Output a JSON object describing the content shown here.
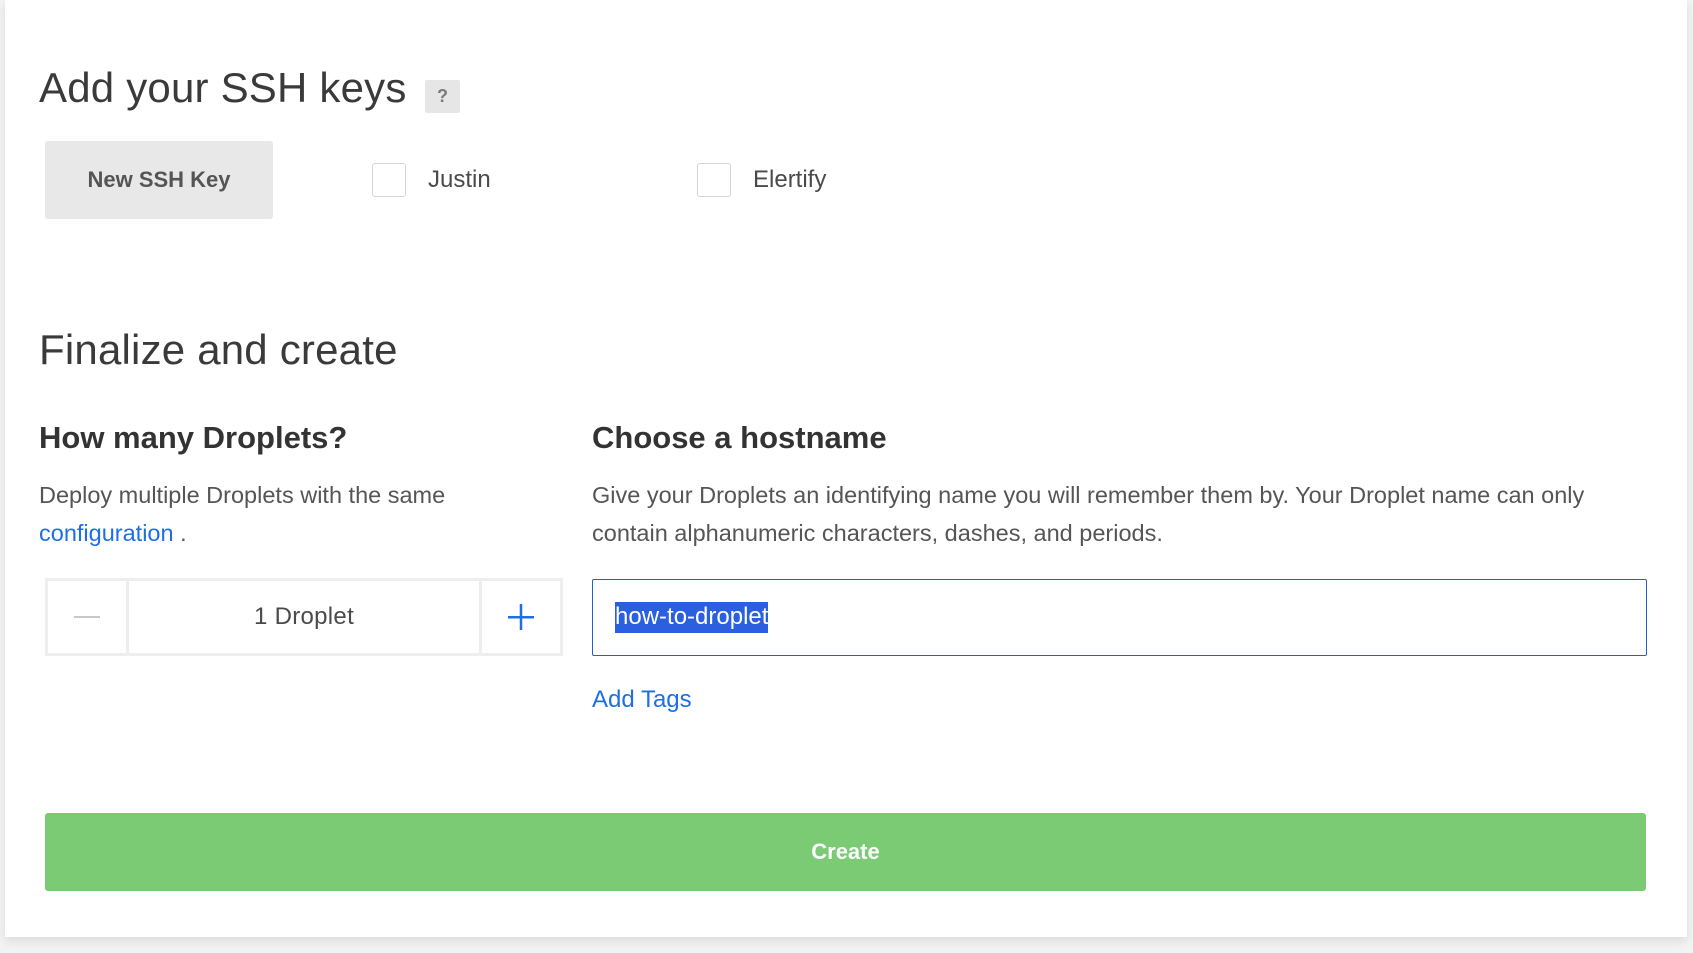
{
  "ssh_section": {
    "title": "Add your SSH keys",
    "help_badge": "?",
    "new_key_label": "New SSH Key",
    "keys": [
      {
        "label": "Justin",
        "checked": false
      },
      {
        "label": "Elertify",
        "checked": false
      }
    ]
  },
  "finalize_section": {
    "title": "Finalize and create",
    "droplets": {
      "title": "How many Droplets?",
      "description": "Deploy multiple Droplets with the same",
      "link_text": "configuration",
      "trailing": " .",
      "count_value": "1  Droplet",
      "minus_icon": "minus-icon",
      "plus_icon": "plus-icon"
    },
    "hostname": {
      "title": "Choose a hostname",
      "description": "Give your Droplets an identifying name you will remember them by. Your Droplet name can only contain alphanumeric characters, dashes, and periods.",
      "input_value": "how-to-droplet",
      "add_tags_label": "Add Tags"
    },
    "create_label": "Create"
  },
  "colors": {
    "link": "#1e6fe6",
    "create_button": "#7acb73",
    "input_border": "#1e5fd6",
    "selection": "#2a5fe0"
  }
}
